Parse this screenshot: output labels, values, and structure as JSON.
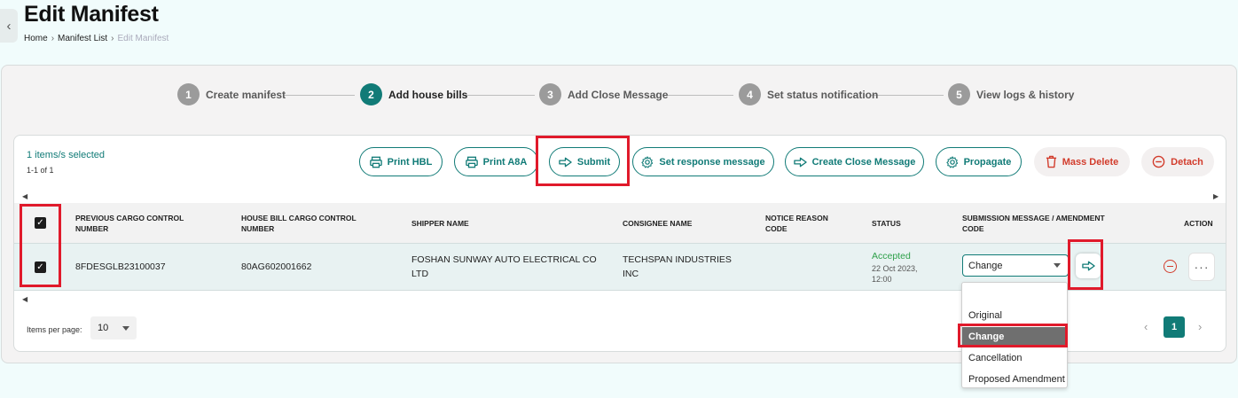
{
  "header": {
    "title": "Edit Manifest",
    "breadcrumb": [
      "Home",
      "Manifest List",
      "Edit Manifest"
    ]
  },
  "stepper": [
    {
      "num": "1",
      "label": "Create manifest"
    },
    {
      "num": "2",
      "label": "Add house bills",
      "active": true
    },
    {
      "num": "3",
      "label": "Add Close Message"
    },
    {
      "num": "4",
      "label": "Set status notification"
    },
    {
      "num": "5",
      "label": "View logs & history"
    }
  ],
  "toolbar": {
    "selection_text": "1 items/s selected",
    "range_text": "1-1 of 1",
    "print_hbl": "Print HBL",
    "print_a8a": "Print A8A",
    "submit": "Submit",
    "set_response": "Set response message",
    "create_close": "Create Close Message",
    "propagate": "Propagate",
    "mass_delete": "Mass Delete",
    "detach": "Detach"
  },
  "table": {
    "headers": {
      "prev_ccn": "PREVIOUS CARGO CONTROL NUMBER",
      "hb_ccn": "HOUSE BILL CARGO CONTROL NUMBER",
      "shipper": "SHIPPER NAME",
      "consignee": "CONSIGNEE NAME",
      "notice": "NOTICE REASON CODE",
      "status": "STATUS",
      "submission": "SUBMISSION MESSAGE / AMENDMENT CODE",
      "action": "ACTION"
    },
    "rows": [
      {
        "prev_ccn": "8FDESGLB23100037",
        "hb_ccn": "80AG602001662",
        "shipper": "FOSHAN SUNWAY AUTO ELECTRICAL CO LTD",
        "consignee": "TECHSPAN INDUSTRIES INC",
        "notice": "",
        "status": "Accepted",
        "status_date": "22 Oct 2023, 12:00",
        "submission_value": "Change"
      }
    ]
  },
  "dropdown": {
    "options": [
      "",
      "Original",
      "Change",
      "Cancellation",
      "Proposed Amendment"
    ],
    "selected": "Change"
  },
  "pagination": {
    "items_per_page_label": "Items per page:",
    "items_per_page": "10",
    "current_page": "1"
  },
  "colors": {
    "accent": "#117b77",
    "danger": "#d23c2c",
    "highlight": "#e01a2b",
    "success": "#2ea04a"
  }
}
